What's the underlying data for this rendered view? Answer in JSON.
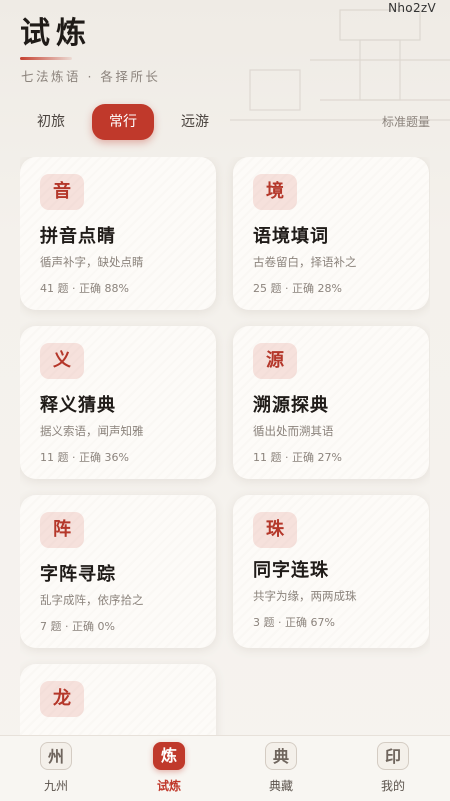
{
  "watermark": "Nho2zV",
  "header": {
    "title": "试炼",
    "subtitle": "七法炼语 · 各择所长"
  },
  "tabs": {
    "items": [
      {
        "label": "初旅",
        "active": false
      },
      {
        "label": "常行",
        "active": true
      },
      {
        "label": "远游",
        "active": false
      }
    ],
    "right_label": "标准题量"
  },
  "cards": [
    {
      "badge": "音",
      "name": "拼音点睛",
      "desc": "循声补字，缺处点睛",
      "stats": "41 题 · 正确 88%"
    },
    {
      "badge": "境",
      "name": "语境填词",
      "desc": "古卷留白，择语补之",
      "stats": "25 题 · 正确 28%"
    },
    {
      "badge": "义",
      "name": "释义猜典",
      "desc": "据义索语，闻声知雅",
      "stats": "11 题 · 正确 36%"
    },
    {
      "badge": "源",
      "name": "溯源探典",
      "desc": "循出处而溯其语",
      "stats": "11 题 · 正确 27%"
    },
    {
      "badge": "阵",
      "name": "字阵寻踪",
      "desc": "乱字成阵，依序拾之",
      "stats": "7 题 · 正确 0%"
    },
    {
      "badge": "珠",
      "name": "同字连珠",
      "desc": "共字为缘，两两成珠",
      "stats": "3 题 · 正确 67%"
    },
    {
      "badge": "龙",
      "name": "",
      "desc": "",
      "stats": ""
    }
  ],
  "bottom_nav": [
    {
      "icon": "州",
      "label": "九州",
      "active": false
    },
    {
      "icon": "炼",
      "label": "试炼",
      "active": true
    },
    {
      "icon": "典",
      "label": "典藏",
      "active": false
    },
    {
      "icon": "印",
      "label": "我的",
      "active": false
    }
  ],
  "colors": {
    "accent": "#c0392b",
    "badge_bg": "#f6e1dc",
    "background": "#f4f1ec"
  }
}
